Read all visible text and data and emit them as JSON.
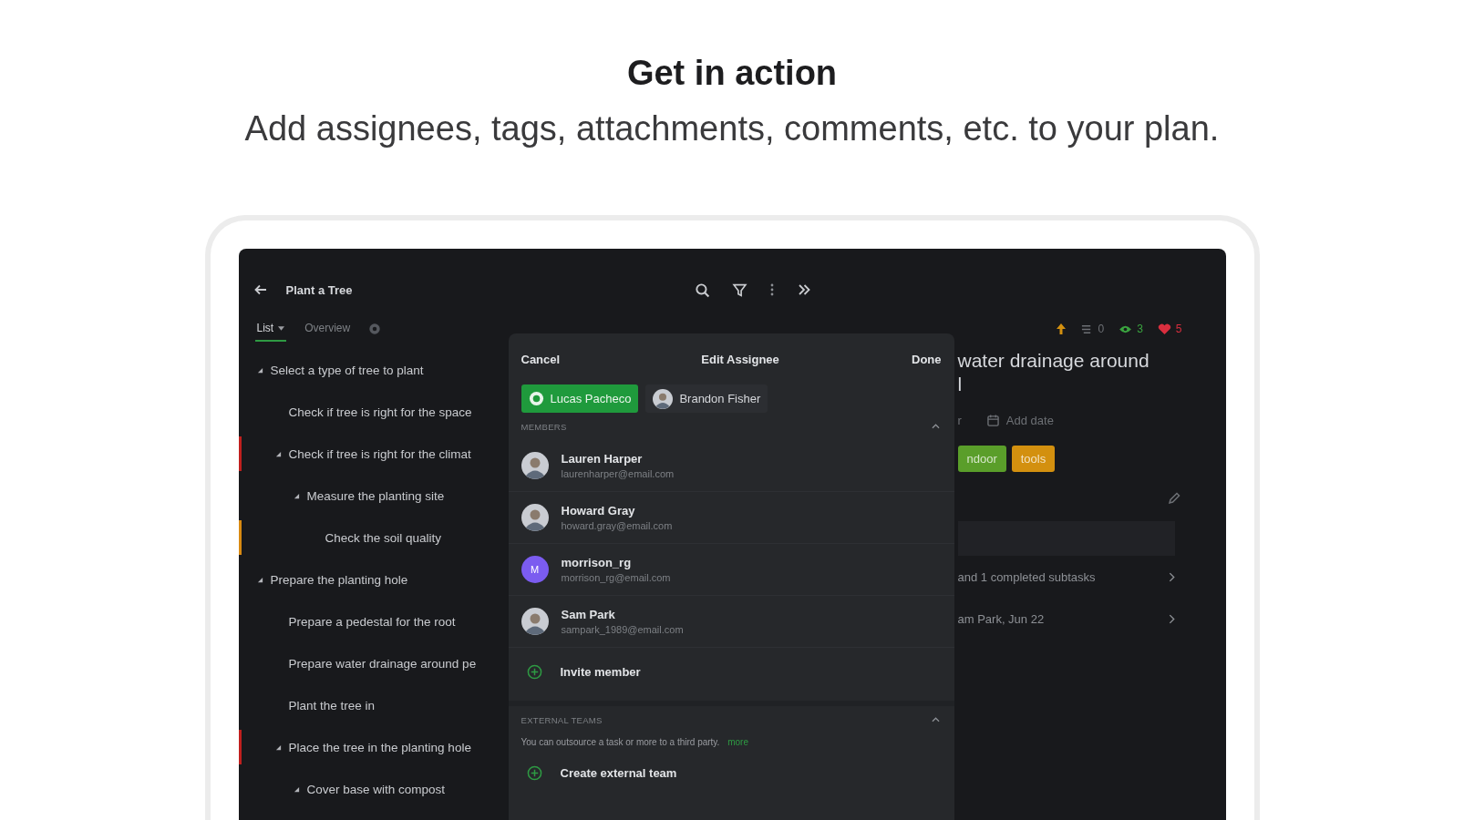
{
  "heading": "Get in action",
  "subheading": "Add assignees, tags, attachments, comments, etc. to your plan.",
  "app": {
    "toolbar": {
      "title": "Plant a Tree"
    },
    "tabs": [
      {
        "label": "List",
        "selected": true,
        "dropdown": true
      },
      {
        "label": "Overview",
        "selected": false
      }
    ],
    "tasks": [
      {
        "title": "Select a type of tree to plant",
        "expanded": true,
        "children": [
          {
            "title": "Check if tree is right for the space"
          },
          {
            "title": "Check if tree is right for the climat",
            "expanded": true,
            "color": "#c0201e",
            "children": [
              {
                "title": "Measure the planting site",
                "expanded": true,
                "children": [
                  {
                    "title": "Check the soil quality",
                    "color": "#d98a12"
                  }
                ]
              }
            ]
          }
        ]
      },
      {
        "title": "Prepare the planting hole",
        "expanded": true,
        "children": [
          {
            "title": "Prepare a pedestal for the root"
          },
          {
            "title": "Prepare water drainage around pe"
          },
          {
            "title": "Plant the tree in"
          },
          {
            "title": "Place the tree in the planting hole",
            "expanded": true,
            "color": "#c0201e",
            "children": [
              {
                "title": "Cover base with compost",
                "expanded": true
              }
            ]
          }
        ]
      }
    ],
    "detail": {
      "stats": [
        {
          "kind": "priority"
        },
        {
          "kind": "comments",
          "count": "0"
        },
        {
          "kind": "watchers",
          "count": "3"
        },
        {
          "kind": "likes",
          "count": "5"
        }
      ],
      "title_lines": [
        "water drainage around",
        "l"
      ],
      "assignee_fragment": "r",
      "date": "Add date",
      "tags": [
        {
          "label": "ndoor",
          "color": "#5a9e2a"
        },
        {
          "label": "tools",
          "color": "#d3900f"
        }
      ],
      "links": [
        "and 1 completed subtasks",
        "am Park, Jun 22"
      ]
    },
    "dialog": {
      "cancel": "Cancel",
      "title": "Edit Assignee",
      "done": "Done",
      "assignees": [
        {
          "name": "Lucas Pacheco",
          "selected": true
        },
        {
          "name": "Brandon Fisher",
          "selected": false
        }
      ],
      "members_label": "MEMBERS",
      "members_expanded": true,
      "members": [
        {
          "name": "Lauren Harper",
          "email": "laurenharper@email.com",
          "kind": "photo"
        },
        {
          "name": "Howard Gray",
          "email": "howard.gray@email.com",
          "kind": "photo"
        },
        {
          "name": "morrison_rg",
          "email": "morrison_rg@email.com",
          "kind": "initial",
          "initial": "M",
          "color": "#7b5cf0"
        },
        {
          "name": "Sam Park",
          "email": "sampark_1989@email.com",
          "kind": "photo"
        }
      ],
      "invite": "Invite member",
      "teams_label": "EXTERNAL TEAMS",
      "teams_expanded": true,
      "teams_note": "You can outsource a task or more to a third party.",
      "teams_more": "more",
      "create_team": "Create external team"
    }
  }
}
